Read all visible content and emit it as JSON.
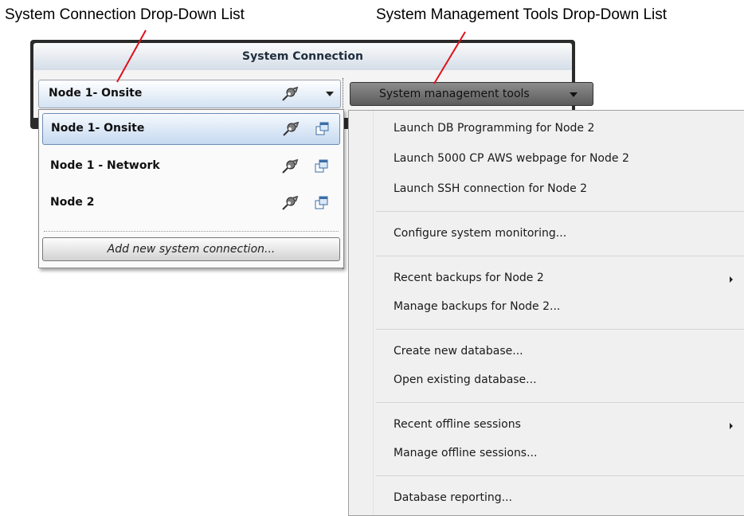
{
  "callouts": {
    "left": "System Connection Drop-Down List",
    "right": "System Management Tools Drop-Down List"
  },
  "panel": {
    "title": "System Connection"
  },
  "connection_combo": {
    "selected": "Node 1- Onsite",
    "icon": "node-connect-icon"
  },
  "tools_button": {
    "label": "System management tools",
    "icon": "chevron-down-icon"
  },
  "connection_list": {
    "items": [
      {
        "label": "Node 1- Onsite",
        "selected": true
      },
      {
        "label": "Node 1 - Network",
        "selected": false
      },
      {
        "label": "Node 2",
        "selected": false
      }
    ],
    "add_button": "Add new system connection..."
  },
  "tools_menu": {
    "items": [
      "Launch DB Programming for Node 2",
      "Launch 5000 CP AWS webpage for Node 2",
      "Launch SSH connection for Node 2",
      "Configure system monitoring...",
      "Recent backups for Node 2",
      "Manage backups for Node 2...",
      "Create new database...",
      "Open existing database...",
      "Recent offline sessions",
      "Manage offline sessions...",
      "Database reporting..."
    ]
  },
  "colors": {
    "callout_line": "#e0101a",
    "panel_dark": "#2b2b2b",
    "selected_fill": "#c6d9f0"
  }
}
